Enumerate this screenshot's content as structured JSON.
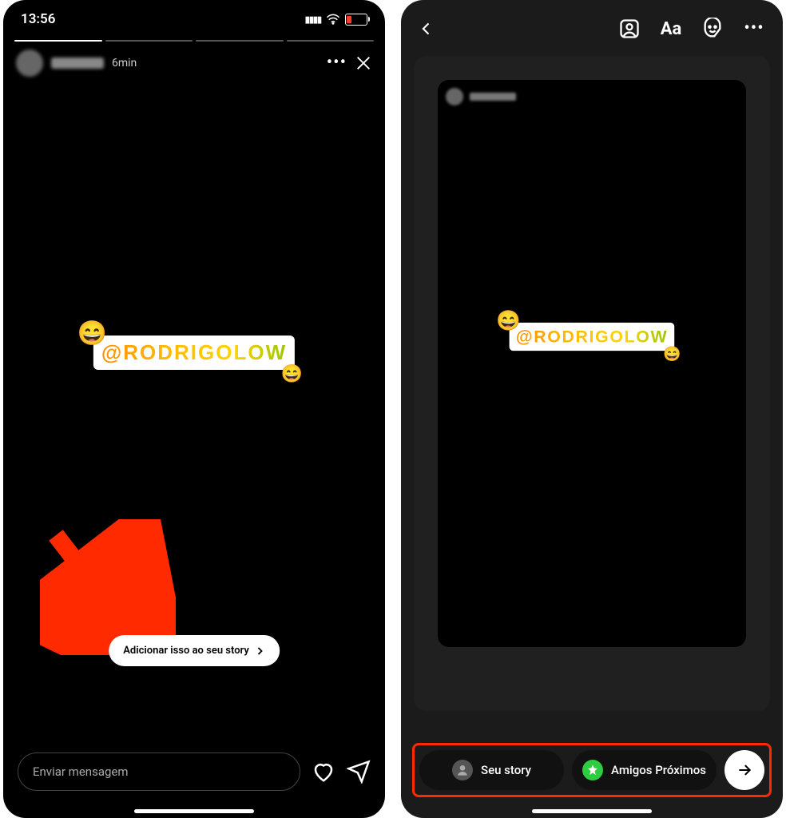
{
  "statusbar": {
    "time": "13:56"
  },
  "story": {
    "timestamp": "6min",
    "mention_text": "@RODRIGOLOW",
    "emoji": "😄"
  },
  "add_button": {
    "label": "Adicionar isso ao seu story"
  },
  "message_input": {
    "placeholder": "Enviar mensagem"
  },
  "share_options": {
    "your_story": "Seu story",
    "close_friends": "Amigos Próximos"
  }
}
